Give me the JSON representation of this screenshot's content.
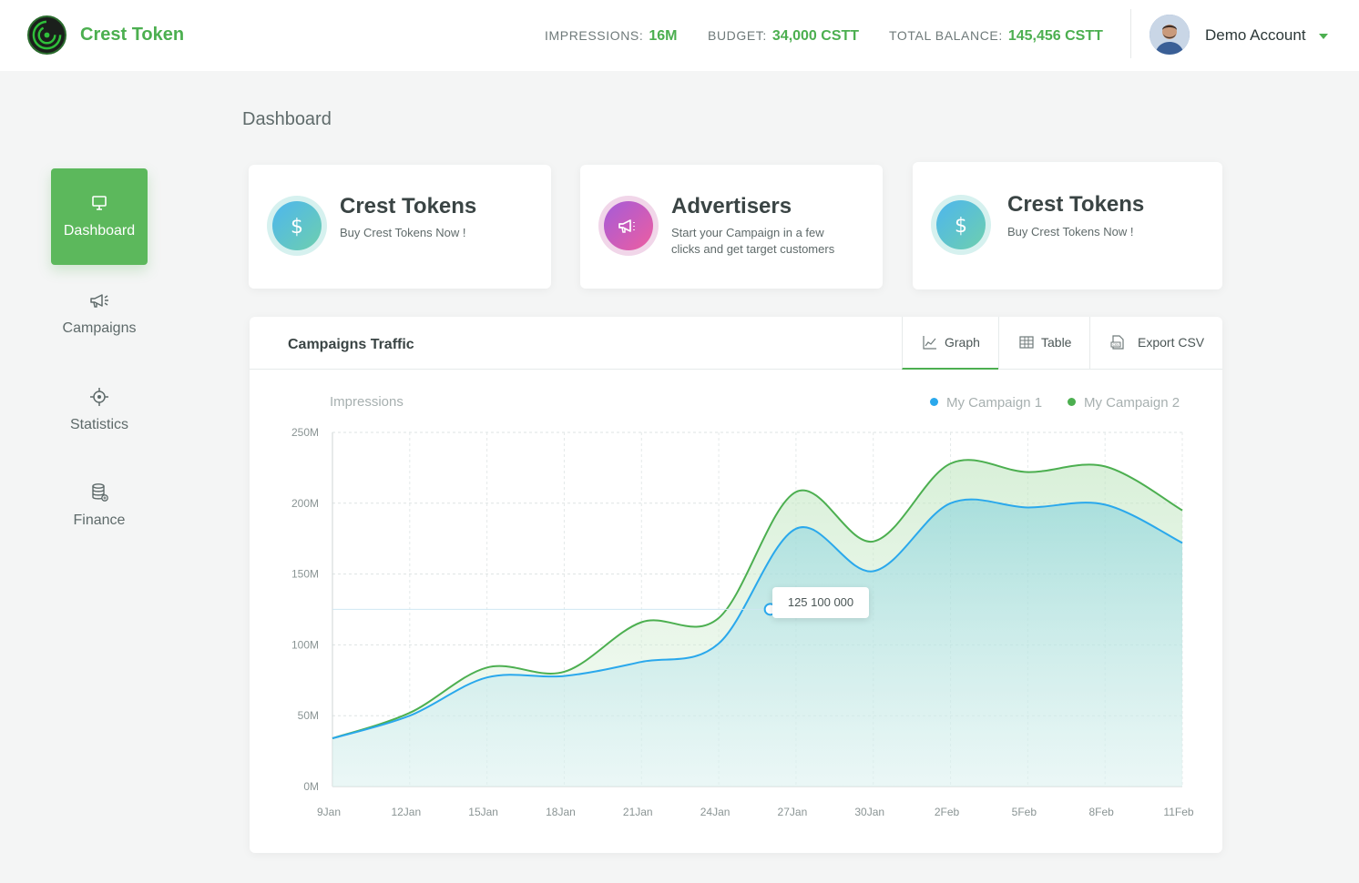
{
  "header": {
    "brand": "Crest Token",
    "stats": [
      {
        "label": "IMPRESSIONS:",
        "value": "16M"
      },
      {
        "label": "BUDGET:",
        "value": "34,000 CSTT"
      },
      {
        "label": "TOTAL BALANCE:",
        "value": "145,456 CSTT"
      }
    ],
    "account": "Demo Account"
  },
  "sidebar": {
    "items": [
      {
        "label": "Dashboard",
        "icon": "presentation-icon",
        "active": true
      },
      {
        "label": "Campaigns",
        "icon": "megaphone-icon"
      },
      {
        "label": "Statistics",
        "icon": "target-icon"
      },
      {
        "label": "Finance",
        "icon": "coins-icon"
      }
    ]
  },
  "page": {
    "title": "Dashboard"
  },
  "cards": [
    {
      "title": "Crest Tokens",
      "subtitle": "Buy Crest Tokens Now !",
      "icon": "dollar-icon"
    },
    {
      "title": "Advertisers",
      "subtitle": "Start your Campaign in a few clicks and get target customers",
      "icon": "megaphone-icon"
    },
    {
      "title": "Crest Tokens",
      "subtitle": "Buy Crest Tokens Now !",
      "icon": "dollar-icon"
    }
  ],
  "traffic": {
    "title": "Campaigns Traffic",
    "tabs": [
      {
        "label": "Graph",
        "icon": "line-chart-icon",
        "active": true
      },
      {
        "label": "Table",
        "icon": "table-icon"
      },
      {
        "label": "Export CSV",
        "icon": "csv-file-icon"
      }
    ],
    "tooltip": "125 100 000"
  },
  "colors": {
    "green": "#4caf50",
    "blue": "#4db6ee",
    "accent": "#5cb85c"
  },
  "chart_data": {
    "type": "area",
    "ylabel": "Impressions",
    "ylim": [
      0,
      250
    ],
    "yticks": [
      "250M",
      "200M",
      "150M",
      "100M",
      "50M",
      "0M"
    ],
    "ytick_values": [
      250,
      200,
      150,
      100,
      50,
      0
    ],
    "x": [
      "9Jan",
      "12Jan",
      "15Jan",
      "18Jan",
      "21Jan",
      "24Jan",
      "27Jan",
      "30Jan",
      "2Feb",
      "5Feb",
      "8Feb",
      "11Feb"
    ],
    "series": [
      {
        "name": "My Campaign 1",
        "color": "#2aa8ec",
        "values": [
          34,
          50,
          77,
          78,
          88,
          101,
          182,
          152,
          200,
          197,
          199,
          172
        ]
      },
      {
        "name": "My Campaign 2",
        "color": "#4caf50",
        "values": [
          34,
          52,
          84,
          81,
          116,
          119,
          208,
          173,
          228,
          222,
          226,
          195
        ]
      }
    ],
    "highlight": {
      "series": 0,
      "x": "25Jan",
      "value": 125.1
    },
    "grid": true,
    "legend": "top-right"
  }
}
